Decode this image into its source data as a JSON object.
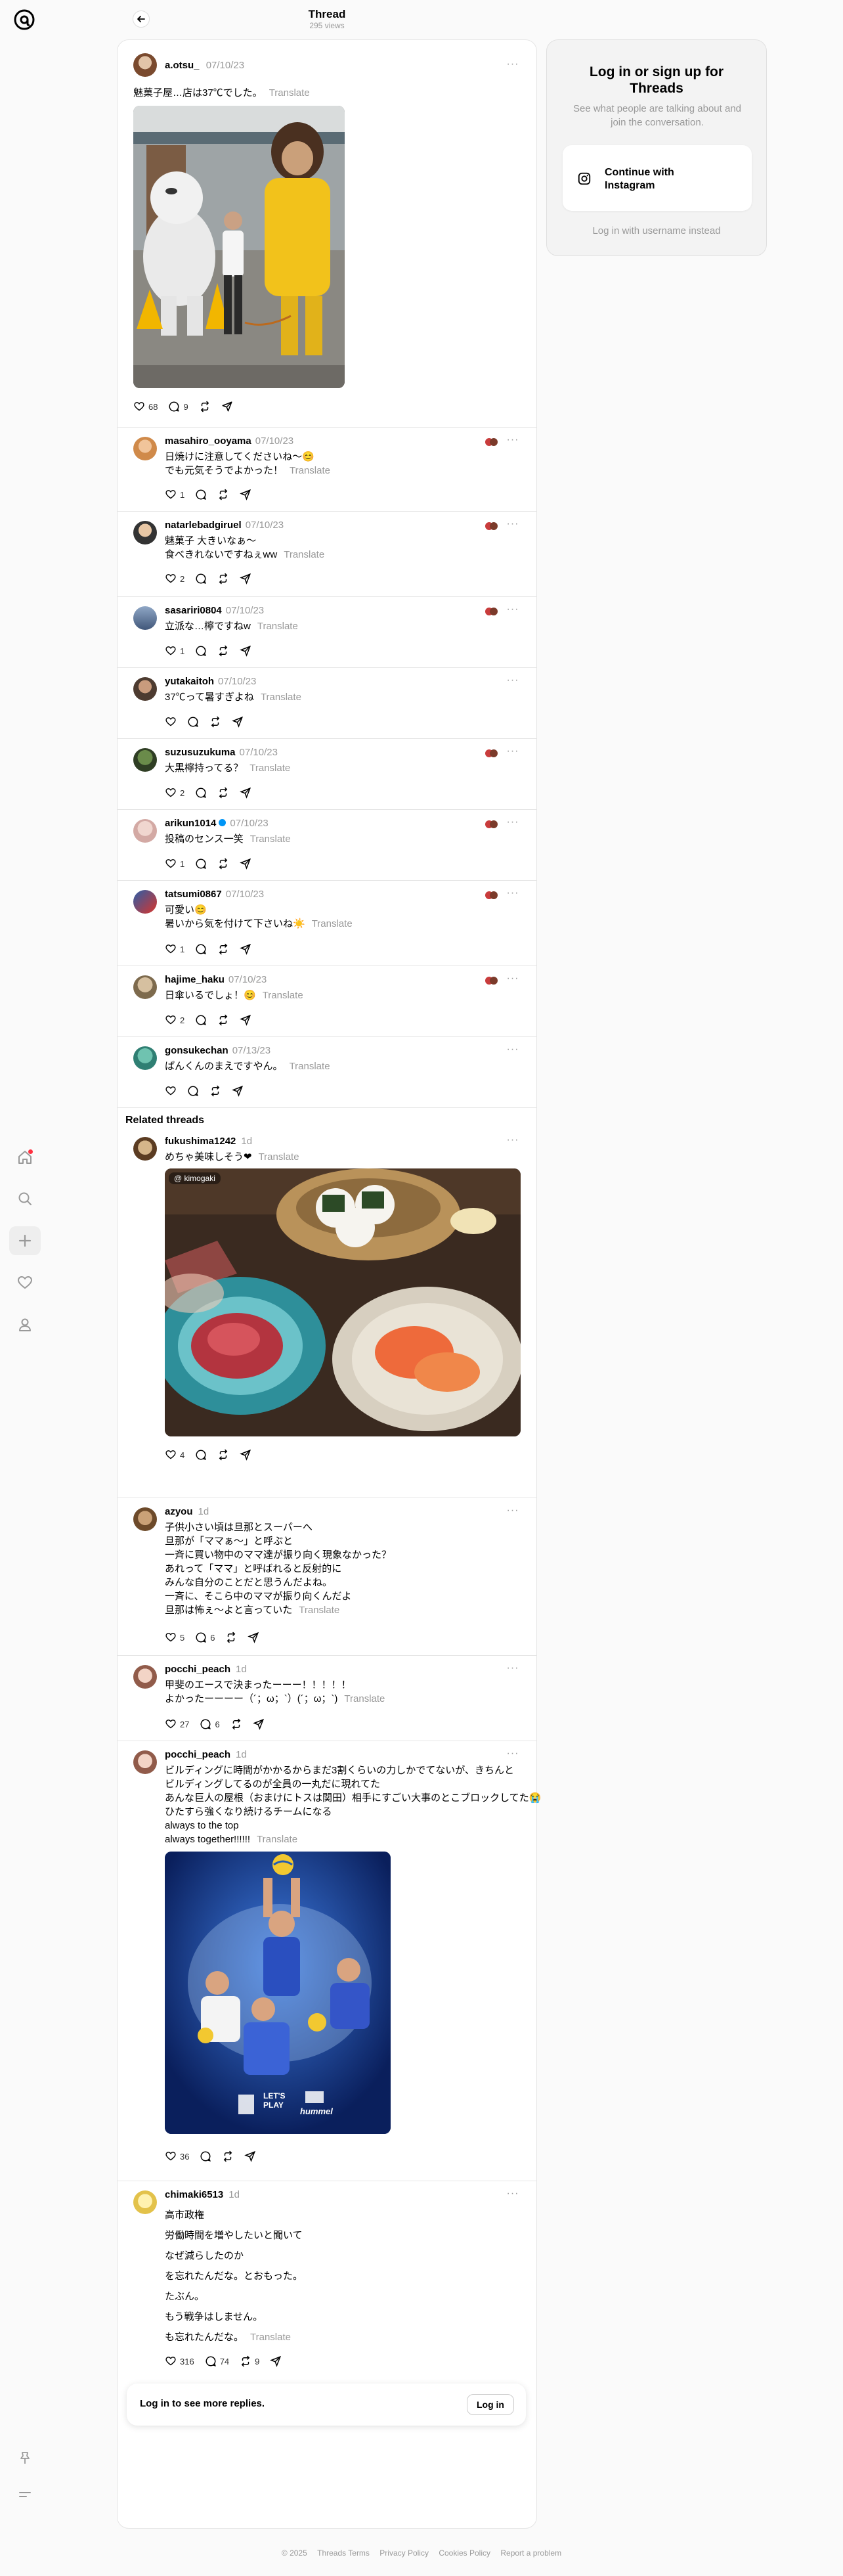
{
  "header": {
    "title": "Thread",
    "views": "295 views"
  },
  "main": {
    "text": "魅菓子屋…店は37℃でした。",
    "translate": "Translate",
    "user": "a.otsu_",
    "date": "07/10/23",
    "likes": "68",
    "comments": "9"
  },
  "replies": [
    {
      "user": "masahiro_ooyama",
      "date": "07/10/23",
      "lines": [
        "日焼けに注意してくださいね〜😊",
        "でも元気そうでよかった！"
      ],
      "likes": "1"
    },
    {
      "user": "natarlebadgiruel",
      "date": "07/10/23",
      "lines": [
        "魅菓子 大きいなぁ〜",
        "食べきれないですねぇww"
      ],
      "likes": "2"
    },
    {
      "user": "sasariri0804",
      "date": "07/10/23",
      "lines": [
        "立派な…檸ですねw"
      ],
      "likes": "1"
    },
    {
      "user": "yutakaitoh",
      "date": "07/10/23",
      "lines": [
        "37℃って暑すぎよね"
      ],
      "likes": ""
    },
    {
      "user": "suzusuzukuma",
      "date": "07/10/23",
      "lines": [
        "大黒檸持ってる？"
      ],
      "likes": "2"
    },
    {
      "user": "arikun1014",
      "date": "07/10/23",
      "lines": [
        "投稿のセンス一笑"
      ],
      "likes": "1"
    },
    {
      "user": "tatsumi0867",
      "date": "07/10/23",
      "lines": [
        "可愛い😊",
        "暑いから気を付けて下さいね☀️"
      ],
      "likes": "1"
    },
    {
      "user": "hajime_haku",
      "date": "07/10/23",
      "lines": [
        "日傘いるでしょ！😊"
      ],
      "likes": "2"
    },
    {
      "user": "gonsukechan",
      "date": "07/13/23",
      "lines": [
        "ぱんくんのまえですやん。"
      ],
      "likes": ""
    }
  ],
  "related": {
    "title": "Related threads",
    "posts": [
      {
        "user": "fukushima1242",
        "date": "1d",
        "lines": [
          "めちゃ美味しそう❤"
        ],
        "likes": "4",
        "comments": "",
        "reposts": "",
        "image_tag": "@ kimogaki"
      },
      {
        "user": "azyou",
        "date": "1d",
        "lines": [
          "子供小さい頃は旦那とスーパーへ",
          "旦那が「ママぁ〜」と呼ぶと",
          "一斉に買い物中のママ達が振り向く現象なかった？",
          "あれって「ママ」と呼ばれると反射的に",
          "みんな自分のことだと思うんだよね。",
          "一斉に、そこら中のママが振り向くんだよ",
          "旦那は怖ぇ〜よと言っていた"
        ],
        "likes": "5",
        "comments": "6",
        "reposts": ""
      },
      {
        "user": "pocchi_peach",
        "date": "1d",
        "lines": [
          "甲斐のエースで決まったーーー！！！！！",
          "よかったーーーー（´；ω；`）(´；ω；`)"
        ],
        "likes": "27",
        "comments": "6",
        "reposts": ""
      },
      {
        "user": "pocchi_peach",
        "date": "1d",
        "lines": [
          "ビルディングに時間がかかるからまだ3割くらいの力しかでてないが、きちんと",
          "ビルディングしてるのが全員の一丸だに現れてた",
          "あんな巨人の屋根（おまけにトスは関田）相手にすごい大事のとこブロックしてた😭",
          "ひたすら強くなり続けるチームになる",
          "always to the top",
          "always together!!!!!!"
        ],
        "likes": "36",
        "comments": "",
        "reposts": "",
        "poster": {
          "brand1": "LET'S",
          "brand2": "PLAY",
          "brand3": "hummel"
        }
      },
      {
        "user": "chimaki6513",
        "date": "1d",
        "lines": [
          "高市政権",
          "労働時間を増やしたいと聞いて",
          "なぜ減らしたのか",
          "を忘れたんだな。とおもった。",
          "たぶん。",
          "もう戦争はしません。",
          "も忘れたんだな。"
        ],
        "likes": "316",
        "comments": "74",
        "reposts": "9"
      }
    ]
  },
  "cta": {
    "text": "Log in to see more replies.",
    "button": "Log in"
  },
  "login": {
    "title": "Log in or sign up for Threads",
    "subtitle": "See what people are talking about and join the conversation.",
    "instagram": "Continue with Instagram",
    "username": "Log in with username instead"
  },
  "footer": [
    "© 2025",
    "Threads Terms",
    "Privacy Policy",
    "Cookies Policy",
    "Report a problem"
  ]
}
